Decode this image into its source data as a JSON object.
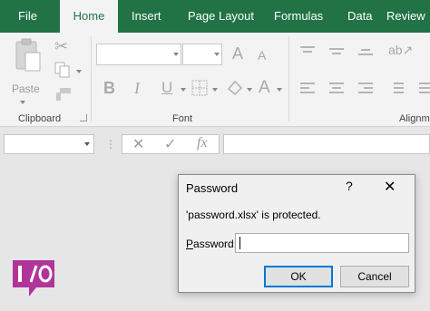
{
  "ribbon_tabs": {
    "file": "File",
    "home": "Home",
    "insert": "Insert",
    "page_layout": "Page Layout",
    "formulas": "Formulas",
    "data": "Data",
    "review": "Review"
  },
  "ribbon": {
    "clipboard": {
      "label": "Clipboard",
      "paste_label": "Paste"
    },
    "font": {
      "label": "Font"
    },
    "alignment": {
      "label": "Alignment"
    }
  },
  "formula_bar": {
    "fx_label": "fx"
  },
  "dialog": {
    "title": "Password",
    "help_glyph": "?",
    "close_glyph": "✕",
    "message": "'password.xlsx' is protected.",
    "password_label": "Password:",
    "password_value": "",
    "ok_label": "OK",
    "cancel_label": "Cancel"
  },
  "colors": {
    "excel_green": "#217346",
    "logo_purple": "#b0359a",
    "focus_blue": "#0078d7"
  }
}
